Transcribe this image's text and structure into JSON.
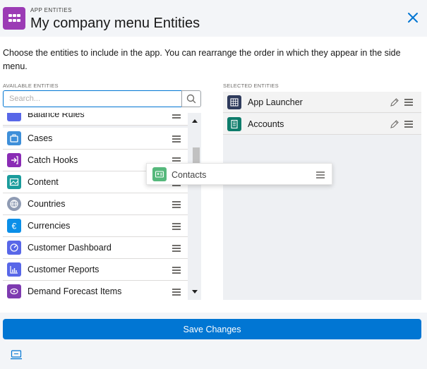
{
  "header": {
    "kicker": "APP ENTITIES",
    "title": "My company menu Entities",
    "app_icon": "app-grid-icon",
    "close_icon": "close-icon"
  },
  "description": "Choose the entities to include in the app. You can rearrange the order in which they appear in the side menu.",
  "available": {
    "label": "AVAILABLE ENTITIES",
    "search": {
      "placeholder": "Search...",
      "value": "",
      "icon": "search-icon"
    },
    "items": [
      {
        "label": "Balance Rules",
        "icon": "rules-icon",
        "color": "#5867e8"
      },
      {
        "label": "Cases",
        "icon": "case-icon",
        "color": "#3e8fd9"
      },
      {
        "label": "Catch Hooks",
        "icon": "hook-icon",
        "color": "#8a2cb5"
      },
      {
        "label": "Content",
        "icon": "content-icon",
        "color": "#1b9c9c"
      },
      {
        "label": "Countries",
        "icon": "globe-icon",
        "color": "#8f9bb3"
      },
      {
        "label": "Currencies",
        "icon": "euro-icon",
        "color": "#0b8fe8"
      },
      {
        "label": "Customer Dashboard",
        "icon": "dashboard-icon",
        "color": "#5867e8"
      },
      {
        "label": "Customer Reports",
        "icon": "report-icon",
        "color": "#5867e8"
      },
      {
        "label": "Demand Forecast Items",
        "icon": "forecast-icon",
        "color": "#7e3bb0"
      }
    ],
    "scrollbar": {
      "position_fraction": 0.2
    }
  },
  "selected": {
    "label": "SELECTED ENTITIES",
    "items": [
      {
        "label": "App Launcher",
        "icon": "app-launcher-icon",
        "color": "#2f3b5c"
      },
      {
        "label": "Accounts",
        "icon": "account-icon",
        "color": "#0e7c6b"
      }
    ]
  },
  "dragging": {
    "label": "Contacts",
    "icon": "contact-icon",
    "color": "#56b87c"
  },
  "footer": {
    "save_label": "Save Changes",
    "bottom_icon": "device-icon"
  },
  "colors": {
    "accent": "#0176d3",
    "app_icon_bg": "#9b3bb5"
  }
}
